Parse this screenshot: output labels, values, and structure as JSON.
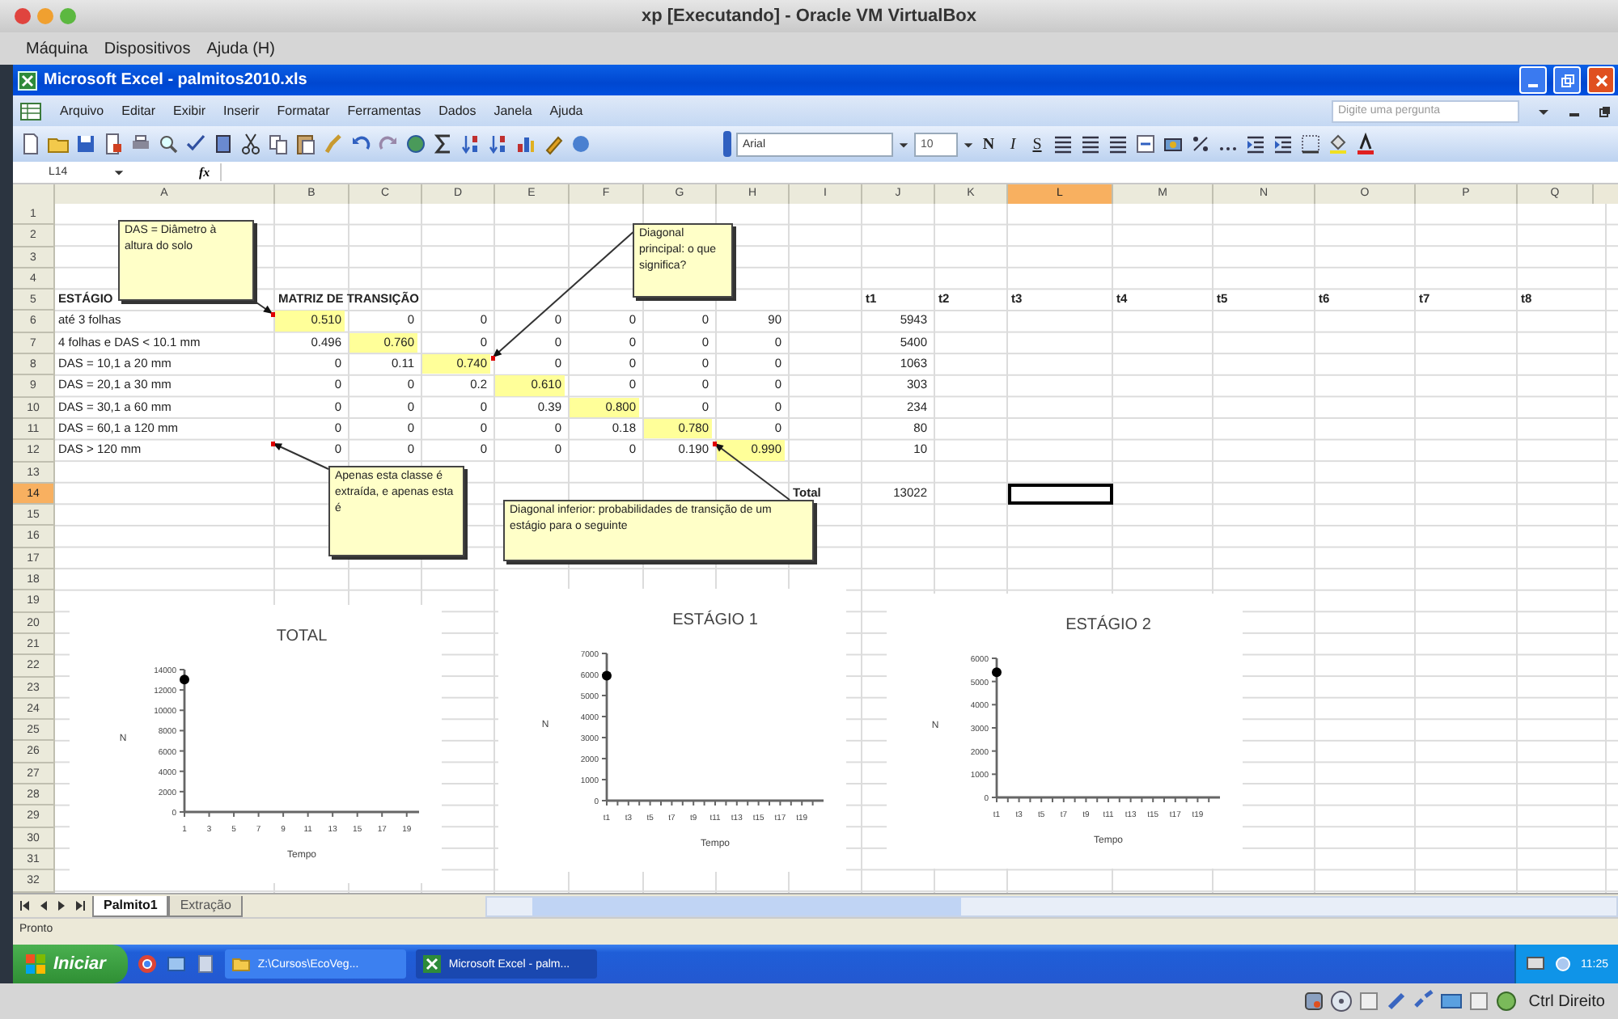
{
  "host_window": {
    "title": "xp [Executando] - Oracle VM VirtualBox",
    "menu": [
      "Máquina",
      "Dispositivos",
      "Ajuda (H)"
    ]
  },
  "excel_window": {
    "title": "Microsoft Excel - palmitos2010.xls"
  },
  "menu_bar": {
    "items": [
      "Arquivo",
      "Editar",
      "Exibir",
      "Inserir",
      "Formatar",
      "Ferramentas",
      "Dados",
      "Janela",
      "Ajuda"
    ],
    "help_placeholder": "Digite uma pergunta"
  },
  "toolbar": {
    "font": "Arial",
    "size": "10",
    "format_buttons": [
      "N",
      "I",
      "S"
    ]
  },
  "formula_bar": {
    "name_box": "L14",
    "function_label": "fx"
  },
  "sheet": {
    "columns": [
      {
        "label": "A",
        "selected": false
      },
      {
        "label": "B",
        "selected": false
      },
      {
        "label": "C",
        "selected": false
      },
      {
        "label": "D",
        "selected": false
      },
      {
        "label": "E",
        "selected": false
      },
      {
        "label": "F",
        "selected": false
      },
      {
        "label": "G",
        "selected": false
      },
      {
        "label": "H",
        "selected": false
      },
      {
        "label": "I",
        "selected": false
      },
      {
        "label": "J",
        "selected": false
      },
      {
        "label": "K",
        "selected": false
      },
      {
        "label": "L",
        "selected": true
      },
      {
        "label": "M",
        "selected": false
      },
      {
        "label": "N",
        "selected": false
      },
      {
        "label": "O",
        "selected": false
      },
      {
        "label": "P",
        "selected": false
      },
      {
        "label": "Q",
        "selected": false
      }
    ],
    "rows": [
      {
        "label": "1",
        "selected": false
      },
      {
        "label": "2",
        "selected": false
      },
      {
        "label": "3",
        "selected": false
      },
      {
        "label": "4",
        "selected": false
      },
      {
        "label": "5",
        "selected": false,
        "cells": [
          {
            "kind": "heading",
            "text": "ESTÁGIO"
          },
          {
            "kind": "heading",
            "text": "MATRIZ DE TRANSIÇÃO"
          },
          null,
          null,
          null,
          null,
          null,
          null,
          null,
          {
            "kind": "heading",
            "text": "t1"
          },
          {
            "kind": "heading",
            "text": "t2"
          },
          {
            "kind": "heading",
            "text": "t3"
          },
          {
            "kind": "heading",
            "text": "t4"
          },
          {
            "kind": "heading",
            "text": "t5"
          },
          {
            "kind": "heading",
            "text": "t6"
          },
          {
            "kind": "heading",
            "text": "t7"
          },
          {
            "kind": "heading",
            "text": "t8"
          }
        ]
      },
      {
        "label": "6",
        "selected": false,
        "cells": [
          {
            "kind": "text",
            "text": "até 3 folhas"
          },
          {
            "kind": "number",
            "text": "0.510",
            "highlighted": true
          },
          {
            "kind": "number",
            "text": "0",
            "highlighted": false
          },
          {
            "kind": "number",
            "text": "0",
            "highlighted": false
          },
          {
            "kind": "number",
            "text": "0",
            "highlighted": false
          },
          {
            "kind": "number",
            "text": "0",
            "highlighted": false
          },
          {
            "kind": "number",
            "text": "0",
            "highlighted": false
          },
          {
            "kind": "number",
            "text": "90",
            "highlighted": false
          },
          null,
          {
            "kind": "number",
            "text": "5943",
            "highlighted": false
          }
        ]
      },
      {
        "label": "7",
        "selected": false,
        "cells": [
          {
            "kind": "text",
            "text": "4 folhas e DAS < 10.1 mm"
          },
          {
            "kind": "number",
            "text": "0.496",
            "highlighted": false
          },
          {
            "kind": "number",
            "text": "0.760",
            "highlighted": true
          },
          {
            "kind": "number",
            "text": "0",
            "highlighted": false
          },
          {
            "kind": "number",
            "text": "0",
            "highlighted": false
          },
          {
            "kind": "number",
            "text": "0",
            "highlighted": false
          },
          {
            "kind": "number",
            "text": "0",
            "highlighted": false
          },
          {
            "kind": "number",
            "text": "0",
            "highlighted": false
          },
          null,
          {
            "kind": "number",
            "text": "5400",
            "highlighted": false
          }
        ]
      },
      {
        "label": "8",
        "selected": false,
        "cells": [
          {
            "kind": "text",
            "text": "DAS = 10,1 a 20 mm"
          },
          {
            "kind": "number",
            "text": "0",
            "highlighted": false
          },
          {
            "kind": "number",
            "text": "0.11",
            "highlighted": false
          },
          {
            "kind": "number",
            "text": "0.740",
            "highlighted": true
          },
          {
            "kind": "number",
            "text": "0",
            "highlighted": false
          },
          {
            "kind": "number",
            "text": "0",
            "highlighted": false
          },
          {
            "kind": "number",
            "text": "0",
            "highlighted": false
          },
          {
            "kind": "number",
            "text": "0",
            "highlighted": false
          },
          null,
          {
            "kind": "number",
            "text": "1063",
            "highlighted": false
          }
        ]
      },
      {
        "label": "9",
        "selected": false,
        "cells": [
          {
            "kind": "text",
            "text": "DAS = 20,1 a 30 mm"
          },
          {
            "kind": "number",
            "text": "0",
            "highlighted": false
          },
          {
            "kind": "number",
            "text": "0",
            "highlighted": false
          },
          {
            "kind": "number",
            "text": "0.2",
            "highlighted": false
          },
          {
            "kind": "number",
            "text": "0.610",
            "highlighted": true
          },
          {
            "kind": "number",
            "text": "0",
            "highlighted": false
          },
          {
            "kind": "number",
            "text": "0",
            "highlighted": false
          },
          {
            "kind": "number",
            "text": "0",
            "highlighted": false
          },
          null,
          {
            "kind": "number",
            "text": "303",
            "highlighted": false
          }
        ]
      },
      {
        "label": "10",
        "selected": false,
        "cells": [
          {
            "kind": "text",
            "text": "DAS = 30,1 a 60 mm"
          },
          {
            "kind": "number",
            "text": "0",
            "highlighted": false
          },
          {
            "kind": "number",
            "text": "0",
            "highlighted": false
          },
          {
            "kind": "number",
            "text": "0",
            "highlighted": false
          },
          {
            "kind": "number",
            "text": "0.39",
            "highlighted": false
          },
          {
            "kind": "number",
            "text": "0.800",
            "highlighted": true
          },
          {
            "kind": "number",
            "text": "0",
            "highlighted": false
          },
          {
            "kind": "number",
            "text": "0",
            "highlighted": false
          },
          null,
          {
            "kind": "number",
            "text": "234",
            "highlighted": false
          }
        ]
      },
      {
        "label": "11",
        "selected": false,
        "cells": [
          {
            "kind": "text",
            "text": "DAS = 60,1 a 120 mm"
          },
          {
            "kind": "number",
            "text": "0",
            "highlighted": false
          },
          {
            "kind": "number",
            "text": "0",
            "highlighted": false
          },
          {
            "kind": "number",
            "text": "0",
            "highlighted": false
          },
          {
            "kind": "number",
            "text": "0",
            "highlighted": false
          },
          {
            "kind": "number",
            "text": "0.18",
            "highlighted": false
          },
          {
            "kind": "number",
            "text": "0.780",
            "highlighted": true
          },
          {
            "kind": "number",
            "text": "0",
            "highlighted": false
          },
          null,
          {
            "kind": "number",
            "text": "80",
            "highlighted": false
          }
        ]
      },
      {
        "label": "12",
        "selected": false,
        "cells": [
          {
            "kind": "text",
            "text": "DAS > 120 mm"
          },
          {
            "kind": "number",
            "text": "0",
            "highlighted": false
          },
          {
            "kind": "number",
            "text": "0",
            "highlighted": false
          },
          {
            "kind": "number",
            "text": "0",
            "highlighted": false
          },
          {
            "kind": "number",
            "text": "0",
            "highlighted": false
          },
          {
            "kind": "number",
            "text": "0",
            "highlighted": false
          },
          {
            "kind": "number",
            "text": "0.190",
            "highlighted": false
          },
          {
            "kind": "number",
            "text": "0.990",
            "highlighted": true
          },
          null,
          {
            "kind": "number",
            "text": "10",
            "highlighted": false
          }
        ]
      },
      {
        "label": "13",
        "selected": false
      },
      {
        "label": "14",
        "selected": true,
        "cells": [
          null,
          null,
          null,
          null,
          null,
          null,
          null,
          null,
          {
            "kind": "heading",
            "text": "Total"
          },
          {
            "kind": "number",
            "text": "13022",
            "highlighted": false
          }
        ]
      },
      {
        "label": "15",
        "selected": false
      },
      {
        "label": "16",
        "selected": false
      },
      {
        "label": "17",
        "selected": false
      },
      {
        "label": "18",
        "selected": false
      },
      {
        "label": "19",
        "selected": false
      },
      {
        "label": "20",
        "selected": false
      },
      {
        "label": "21",
        "selected": false
      },
      {
        "label": "22",
        "selected": false
      },
      {
        "label": "23",
        "selected": false
      },
      {
        "label": "24",
        "selected": false
      },
      {
        "label": "25",
        "selected": false
      },
      {
        "label": "26",
        "selected": false
      },
      {
        "label": "27",
        "selected": false
      },
      {
        "label": "28",
        "selected": false
      },
      {
        "label": "29",
        "selected": false
      },
      {
        "label": "30",
        "selected": false
      },
      {
        "label": "31",
        "selected": false
      },
      {
        "label": "32",
        "selected": false
      }
    ],
    "comments": [
      {
        "text": "DAS = Diâmetro à altura do solo"
      },
      {
        "text": "Diagonal principal: o que significa?"
      },
      {
        "text": "Apenas esta classe é extraída, e apenas esta é"
      },
      {
        "text": "Diagonal inferior: probabilidades de transição de um estágio para o seguinte"
      }
    ],
    "charts": [
      {
        "chart_data": {
          "type": "scatter",
          "title": "TOTAL",
          "xlabel": "Tempo",
          "ylabel": "N",
          "x": [
            1
          ],
          "series": [
            {
              "color": "#000000",
              "values": [
                13022
              ]
            }
          ],
          "xlim": [
            1,
            20
          ],
          "ylim": [
            0,
            14000
          ],
          "xticks": [
            1,
            3,
            5,
            7,
            9,
            11,
            13,
            15,
            17,
            19
          ],
          "yticks": [
            0,
            2000,
            4000,
            6000,
            8000,
            10000,
            12000,
            14000
          ]
        }
      },
      {
        "chart_data": {
          "type": "scatter",
          "title": "ESTÁGIO 1",
          "xlabel": "Tempo",
          "ylabel": "N",
          "categories": [
            "t1",
            null,
            "t3",
            null,
            "t5",
            null,
            "t7",
            null,
            "t9",
            null,
            "t11",
            null,
            "t13",
            null,
            "t15",
            null,
            "t17",
            null,
            "t19",
            null
          ],
          "series": [
            {
              "color": "#000000",
              "values": [
                5943,
                null,
                null,
                null,
                null,
                null,
                null,
                null,
                null,
                null,
                null,
                null,
                null,
                null,
                null,
                null,
                null,
                null,
                null,
                null
              ]
            }
          ],
          "ylim": [
            0,
            7000
          ],
          "yticks": [
            0,
            1000,
            2000,
            3000,
            4000,
            5000,
            6000,
            7000
          ]
        }
      },
      {
        "chart_data": {
          "type": "scatter",
          "title": "ESTÁGIO 2",
          "xlabel": "Tempo",
          "ylabel": "N",
          "categories": [
            "t1",
            null,
            "t3",
            null,
            "t5",
            null,
            "t7",
            null,
            "t9",
            null,
            "t11",
            null,
            "t13",
            null,
            "t15",
            null,
            "t17",
            null,
            "t19",
            null
          ],
          "series": [
            {
              "color": "#000000",
              "values": [
                5400,
                null,
                null,
                null,
                null,
                null,
                null,
                null,
                null,
                null,
                null,
                null,
                null,
                null,
                null,
                null,
                null,
                null,
                null,
                null
              ]
            }
          ],
          "ylim": [
            0,
            6000
          ],
          "yticks": [
            0,
            1000,
            2000,
            3000,
            4000,
            5000,
            6000
          ]
        }
      }
    ]
  },
  "sheet_tabs": [
    {
      "label": "Palmito1",
      "selected": true
    },
    {
      "label": "Extração",
      "selected": false
    }
  ],
  "status_bar": {
    "text": "Pronto"
  },
  "taskbar": {
    "start": "Iniciar",
    "tasks": [
      {
        "label": "Z:\\Cursos\\EcoVeg...",
        "selected": false
      },
      {
        "label": "Microsoft Excel - palm...",
        "selected": true
      }
    ],
    "clock": "11:25"
  },
  "host_status": {
    "key_label": "Ctrl Direito"
  }
}
